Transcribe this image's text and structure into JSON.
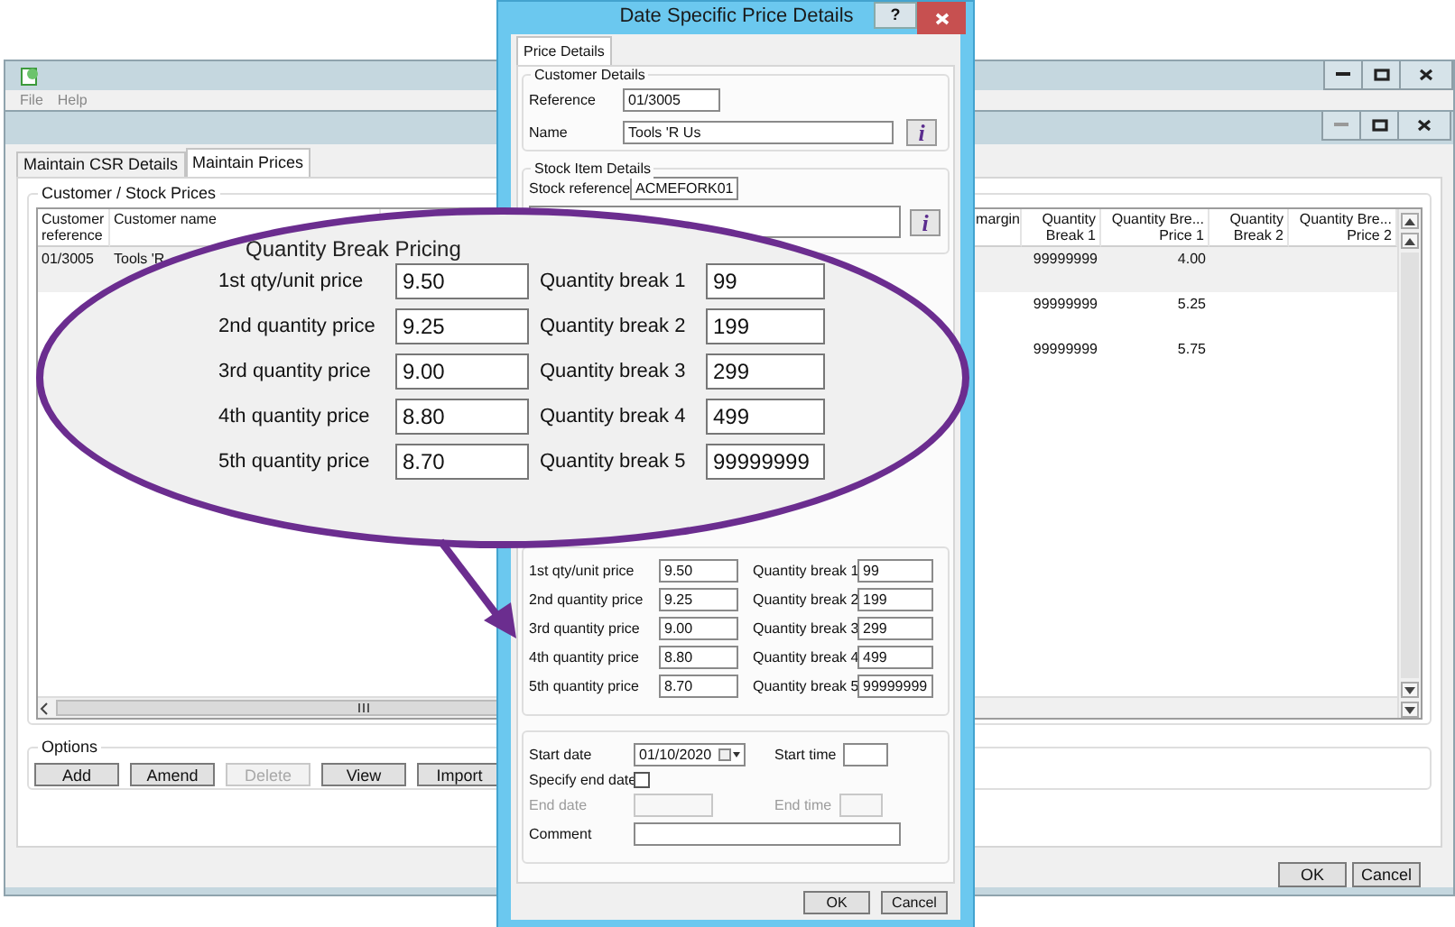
{
  "main_window": {
    "menu": [
      "File",
      "Help"
    ],
    "tabs": [
      {
        "label": "Maintain CSR Details",
        "selected": false
      },
      {
        "label": "Maintain Prices",
        "selected": true
      }
    ],
    "prices_group": {
      "title": "Customer / Stock Prices",
      "columns": [
        "Customer\nreference",
        "Customer name",
        "margin",
        "Quantity\nBreak 1",
        "Quantity Bre...\nPrice 1",
        "Quantity\nBreak 2",
        "Quantity Bre...\nPrice 2"
      ],
      "rows": [
        {
          "selected": true,
          "reference": "01/3005",
          "name": "Tools 'R",
          "quantity_break_1": "99999999",
          "price_1": "4.00"
        },
        {
          "selected": false,
          "quantity_break_1": "99999999",
          "price_1": "5.25"
        },
        {
          "selected": false,
          "quantity_break_1": "99999999",
          "price_1": "5.75"
        }
      ]
    },
    "options": {
      "title": "Options",
      "buttons": [
        {
          "label": "Add",
          "disabled": false
        },
        {
          "label": "Amend",
          "disabled": false
        },
        {
          "label": "Delete",
          "disabled": true
        },
        {
          "label": "View",
          "disabled": false
        },
        {
          "label": "Import",
          "disabled": false
        }
      ]
    },
    "buttons": [
      "OK",
      "Cancel"
    ]
  },
  "dialog": {
    "title": "Date Specific Price Details",
    "help_button": "?",
    "tab": {
      "label": "Price Details",
      "selected": true
    },
    "customer_details": {
      "title": "Customer Details",
      "reference_label": "Reference",
      "reference": "01/3005",
      "name_label": "Name",
      "name": "Tools 'R Us",
      "info_button": "i"
    },
    "stock_item_details": {
      "title": "Stock Item Details",
      "reference_label": "Stock reference",
      "reference": "ACMEFORK01",
      "info_button": "i"
    },
    "quantity_breaks": [
      {
        "price_label": "1st qty/unit price",
        "price": "9.50",
        "break_label": "Quantity break 1",
        "break": "99"
      },
      {
        "price_label": "2nd quantity price",
        "price": "9.25",
        "break_label": "Quantity break 2",
        "break": "199"
      },
      {
        "price_label": "3rd quantity price",
        "price": "9.00",
        "break_label": "Quantity break 3",
        "break": "299"
      },
      {
        "price_label": "4th quantity price",
        "price": "8.80",
        "break_label": "Quantity break 4",
        "break": "499"
      },
      {
        "price_label": "5th quantity price",
        "price": "8.70",
        "break_label": "Quantity break 5",
        "break": "99999999"
      }
    ],
    "dates": {
      "start_date_label": "Start date",
      "start_date": "01/10/2020",
      "start_time_label": "Start time",
      "specify_end_date_label": "Specify end date",
      "specify_end_date": false,
      "end_date_label": "End date",
      "end_time_label": "End time",
      "end_disabled": true,
      "comment_label": "Comment"
    },
    "buttons": [
      "OK",
      "Cancel"
    ]
  },
  "callout": {
    "title": "Quantity Break Pricing",
    "rows": [
      {
        "price_label": "1st qty/unit price",
        "price": "9.50",
        "break_label": "Quantity break 1",
        "break": "99"
      },
      {
        "price_label": "2nd quantity price",
        "price": "9.25",
        "break_label": "Quantity break 2",
        "break": "199"
      },
      {
        "price_label": "3rd quantity price",
        "price": "9.00",
        "break_label": "Quantity break 3",
        "break": "299"
      },
      {
        "price_label": "4th quantity price",
        "price": "8.80",
        "break_label": "Quantity break 4",
        "break": "499"
      },
      {
        "price_label": "5th quantity price",
        "price": "8.70",
        "break_label": "Quantity break 5",
        "break": "99999999"
      }
    ]
  }
}
